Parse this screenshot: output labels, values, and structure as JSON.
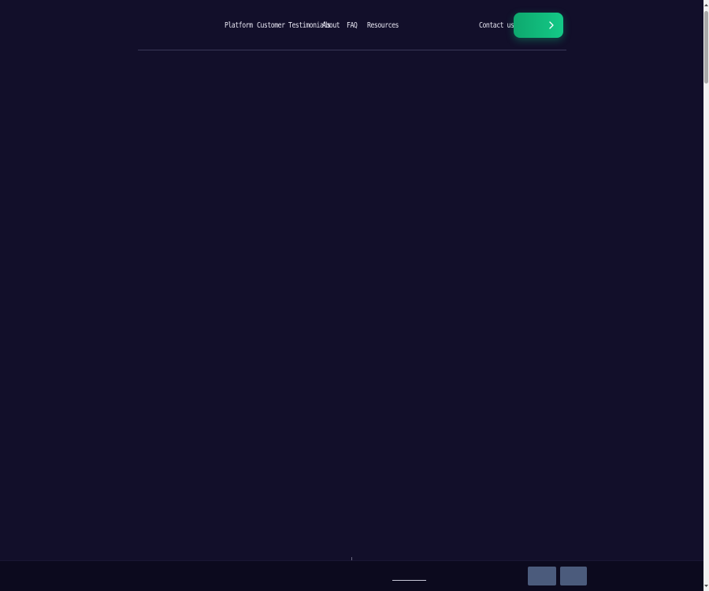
{
  "header": {
    "nav": {
      "platform": "Platform",
      "testimonials": "Customer Testimonials",
      "about": "About",
      "faq": "FAQ",
      "resources": "Resources",
      "contact": "Contact us"
    },
    "cta": {
      "label": "",
      "icon": "chevron-right-icon",
      "color_start": "#0ea86e",
      "color_end": "#14c987"
    }
  },
  "colors": {
    "background": "#120f2a",
    "bottom_bar": "#0c0a1e",
    "bottom_button": "#4b5b7c",
    "nav_text": "#e7e6f2"
  },
  "footer_bar": {
    "buttons": [
      {
        "label": ""
      },
      {
        "label": ""
      }
    ]
  }
}
